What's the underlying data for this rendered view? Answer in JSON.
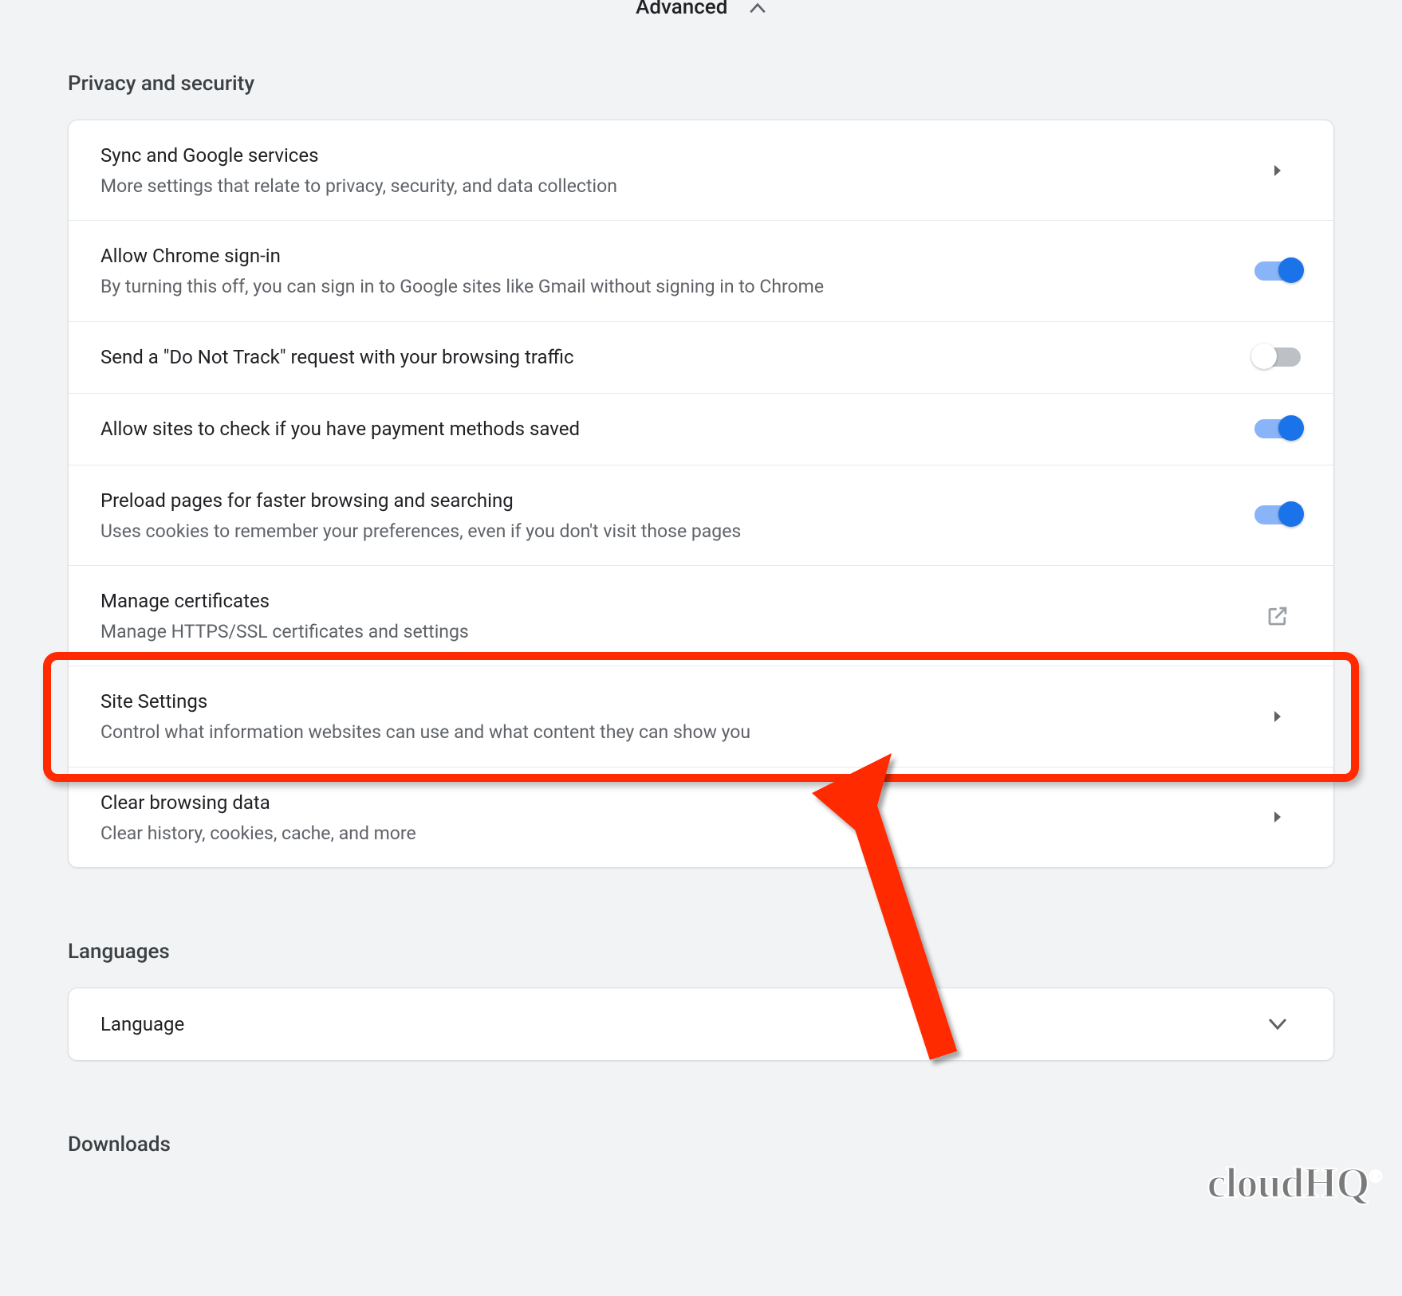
{
  "advanced_label": "Advanced",
  "sections": {
    "privacy": {
      "title": "Privacy and security",
      "rows": {
        "sync": {
          "title": "Sync and Google services",
          "sub": "More settings that relate to privacy, security, and data collection"
        },
        "signin": {
          "title": "Allow Chrome sign-in",
          "sub": "By turning this off, you can sign in to Google sites like Gmail without signing in to Chrome"
        },
        "dnt": {
          "title": "Send a \"Do Not Track\" request with your browsing traffic"
        },
        "payment": {
          "title": "Allow sites to check if you have payment methods saved"
        },
        "preload": {
          "title": "Preload pages for faster browsing and searching",
          "sub": "Uses cookies to remember your preferences, even if you don't visit those pages"
        },
        "certs": {
          "title": "Manage certificates",
          "sub": "Manage HTTPS/SSL certificates and settings"
        },
        "site": {
          "title": "Site Settings",
          "sub": "Control what information websites can use and what content they can show you"
        },
        "clear": {
          "title": "Clear browsing data",
          "sub": "Clear history, cookies, cache, and more"
        }
      }
    },
    "languages": {
      "title": "Languages",
      "row": {
        "title": "Language"
      }
    },
    "downloads": {
      "title": "Downloads"
    }
  },
  "toggles": {
    "signin": true,
    "dnt": false,
    "payment": true,
    "preload": true
  },
  "watermark": "cloudHQ"
}
